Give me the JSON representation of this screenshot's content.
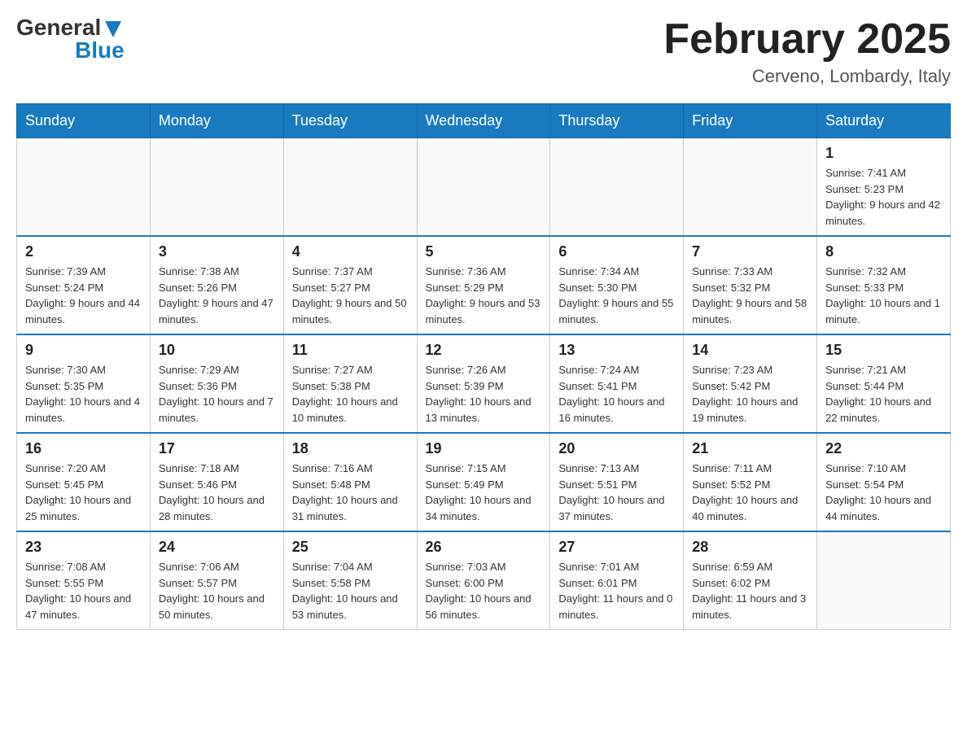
{
  "header": {
    "logo_general": "General",
    "logo_blue": "Blue",
    "month_title": "February 2025",
    "location": "Cerveno, Lombardy, Italy"
  },
  "days_of_week": [
    "Sunday",
    "Monday",
    "Tuesday",
    "Wednesday",
    "Thursday",
    "Friday",
    "Saturday"
  ],
  "weeks": [
    [
      {
        "day": "",
        "info": ""
      },
      {
        "day": "",
        "info": ""
      },
      {
        "day": "",
        "info": ""
      },
      {
        "day": "",
        "info": ""
      },
      {
        "day": "",
        "info": ""
      },
      {
        "day": "",
        "info": ""
      },
      {
        "day": "1",
        "info": "Sunrise: 7:41 AM\nSunset: 5:23 PM\nDaylight: 9 hours and 42 minutes."
      }
    ],
    [
      {
        "day": "2",
        "info": "Sunrise: 7:39 AM\nSunset: 5:24 PM\nDaylight: 9 hours and 44 minutes."
      },
      {
        "day": "3",
        "info": "Sunrise: 7:38 AM\nSunset: 5:26 PM\nDaylight: 9 hours and 47 minutes."
      },
      {
        "day": "4",
        "info": "Sunrise: 7:37 AM\nSunset: 5:27 PM\nDaylight: 9 hours and 50 minutes."
      },
      {
        "day": "5",
        "info": "Sunrise: 7:36 AM\nSunset: 5:29 PM\nDaylight: 9 hours and 53 minutes."
      },
      {
        "day": "6",
        "info": "Sunrise: 7:34 AM\nSunset: 5:30 PM\nDaylight: 9 hours and 55 minutes."
      },
      {
        "day": "7",
        "info": "Sunrise: 7:33 AM\nSunset: 5:32 PM\nDaylight: 9 hours and 58 minutes."
      },
      {
        "day": "8",
        "info": "Sunrise: 7:32 AM\nSunset: 5:33 PM\nDaylight: 10 hours and 1 minute."
      }
    ],
    [
      {
        "day": "9",
        "info": "Sunrise: 7:30 AM\nSunset: 5:35 PM\nDaylight: 10 hours and 4 minutes."
      },
      {
        "day": "10",
        "info": "Sunrise: 7:29 AM\nSunset: 5:36 PM\nDaylight: 10 hours and 7 minutes."
      },
      {
        "day": "11",
        "info": "Sunrise: 7:27 AM\nSunset: 5:38 PM\nDaylight: 10 hours and 10 minutes."
      },
      {
        "day": "12",
        "info": "Sunrise: 7:26 AM\nSunset: 5:39 PM\nDaylight: 10 hours and 13 minutes."
      },
      {
        "day": "13",
        "info": "Sunrise: 7:24 AM\nSunset: 5:41 PM\nDaylight: 10 hours and 16 minutes."
      },
      {
        "day": "14",
        "info": "Sunrise: 7:23 AM\nSunset: 5:42 PM\nDaylight: 10 hours and 19 minutes."
      },
      {
        "day": "15",
        "info": "Sunrise: 7:21 AM\nSunset: 5:44 PM\nDaylight: 10 hours and 22 minutes."
      }
    ],
    [
      {
        "day": "16",
        "info": "Sunrise: 7:20 AM\nSunset: 5:45 PM\nDaylight: 10 hours and 25 minutes."
      },
      {
        "day": "17",
        "info": "Sunrise: 7:18 AM\nSunset: 5:46 PM\nDaylight: 10 hours and 28 minutes."
      },
      {
        "day": "18",
        "info": "Sunrise: 7:16 AM\nSunset: 5:48 PM\nDaylight: 10 hours and 31 minutes."
      },
      {
        "day": "19",
        "info": "Sunrise: 7:15 AM\nSunset: 5:49 PM\nDaylight: 10 hours and 34 minutes."
      },
      {
        "day": "20",
        "info": "Sunrise: 7:13 AM\nSunset: 5:51 PM\nDaylight: 10 hours and 37 minutes."
      },
      {
        "day": "21",
        "info": "Sunrise: 7:11 AM\nSunset: 5:52 PM\nDaylight: 10 hours and 40 minutes."
      },
      {
        "day": "22",
        "info": "Sunrise: 7:10 AM\nSunset: 5:54 PM\nDaylight: 10 hours and 44 minutes."
      }
    ],
    [
      {
        "day": "23",
        "info": "Sunrise: 7:08 AM\nSunset: 5:55 PM\nDaylight: 10 hours and 47 minutes."
      },
      {
        "day": "24",
        "info": "Sunrise: 7:06 AM\nSunset: 5:57 PM\nDaylight: 10 hours and 50 minutes."
      },
      {
        "day": "25",
        "info": "Sunrise: 7:04 AM\nSunset: 5:58 PM\nDaylight: 10 hours and 53 minutes."
      },
      {
        "day": "26",
        "info": "Sunrise: 7:03 AM\nSunset: 6:00 PM\nDaylight: 10 hours and 56 minutes."
      },
      {
        "day": "27",
        "info": "Sunrise: 7:01 AM\nSunset: 6:01 PM\nDaylight: 11 hours and 0 minutes."
      },
      {
        "day": "28",
        "info": "Sunrise: 6:59 AM\nSunset: 6:02 PM\nDaylight: 11 hours and 3 minutes."
      },
      {
        "day": "",
        "info": ""
      }
    ]
  ]
}
